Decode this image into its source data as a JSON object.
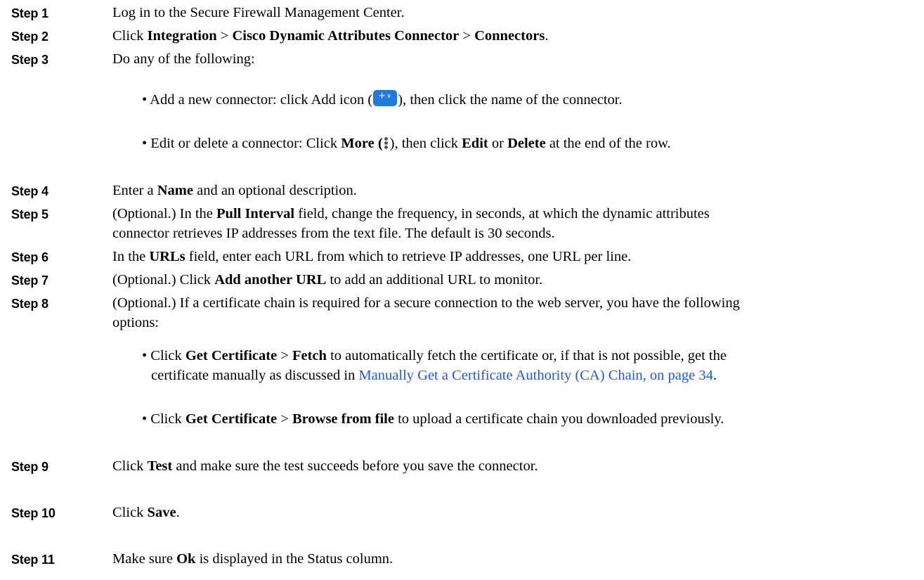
{
  "steps": [
    {
      "label": "Step 1",
      "text": "Log in to the Secure Firewall Management Center."
    },
    {
      "label": "Step 2",
      "click": "Click",
      "nav1": "Integration",
      "sep1": ">",
      "nav2": "Cisco Dynamic Attributes Connector",
      "sep2": ">",
      "nav3": "Connectors",
      "end": "."
    },
    {
      "label": "Step 3",
      "text": "Do any of the following:",
      "bullets": [
        {
          "prefix": "• Add a new connector: click Add icon (",
          "suffix": "), then click the name of the connector."
        },
        {
          "prefix": "• Edit or delete a connector: Click",
          "more": "More",
          "open": "(",
          "mid": "), then click",
          "edit": "Edit",
          "or": "or",
          "delete": "Delete",
          "end": "at the end of the row."
        }
      ]
    },
    {
      "label": "Step 4",
      "pre": "Enter a",
      "bold": "Name",
      "post": "and an optional description."
    },
    {
      "label": "Step 5",
      "pre": "(Optional.) In the",
      "bold": "Pull Interval",
      "post": "field, change the frequency, in seconds, at which the dynamic attributes",
      "line2": "connector retrieves IP addresses from the text file. The default is 30 seconds."
    },
    {
      "label": "Step 6",
      "pre": "In the",
      "bold": "URLs",
      "post": "field, enter each URL from which to retrieve IP addresses, one URL per line."
    },
    {
      "label": "Step 7",
      "pre": "(Optional.) Click",
      "bold": "Add another URL",
      "post": "to add an additional URL to monitor."
    },
    {
      "label": "Step 8",
      "line1": "(Optional.) If a certificate chain is required for a secure connection to the web server, you have the following",
      "line2": "options:",
      "bullets": [
        {
          "pre": "• Click",
          "b1": "Get Certificate",
          "sep": ">",
          "b2": "Fetch",
          "post": "to automatically fetch the certificate or, if that is not possible, get the",
          "line2": "certificate manually as discussed in",
          "link": "Manually Get a Certificate Authority (CA) Chain, on page 34",
          "end": "."
        },
        {
          "pre": "• Click",
          "b1": "Get Certificate",
          "sep": ">",
          "b2": "Browse from file",
          "post": "to upload a certificate chain you downloaded previously."
        }
      ]
    },
    {
      "label": "Step 9",
      "pre": "Click",
      "bold": "Test",
      "post": "and make sure the test succeeds before you save the connector."
    },
    {
      "label": "Step 10",
      "pre": "Click",
      "bold": "Save",
      "post": "."
    },
    {
      "label": "Step 11",
      "pre": "Make sure",
      "bold": "Ok",
      "post": "is displayed in the Status column."
    }
  ],
  "icons": {
    "add": "add-dropdown-icon",
    "more": "more-vertical-icon",
    "add_color": "#1f7ae0"
  },
  "colors": {
    "link": "#1f57d6"
  }
}
